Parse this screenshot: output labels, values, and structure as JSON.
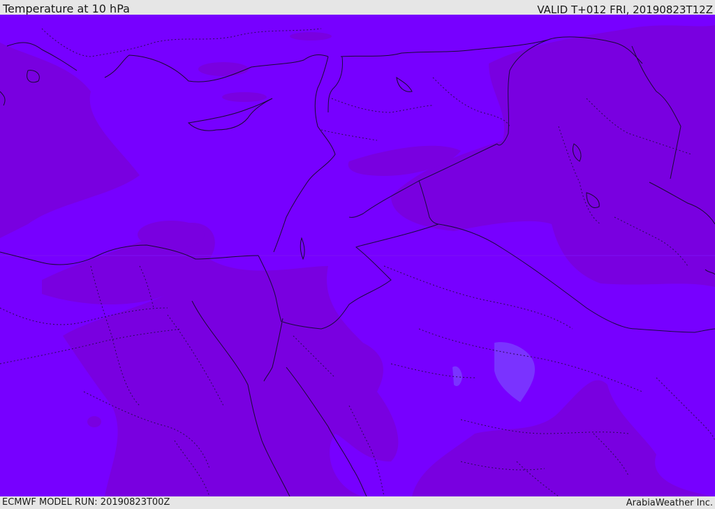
{
  "header": {
    "title": "Temperature at 10 hPa",
    "valid_time": "VALID T+012 FRI, 20190823T12Z"
  },
  "footer": {
    "model_run": "ECMWF MODEL RUN: 20190823T00Z",
    "credit": "ArabiaWeather Inc."
  },
  "map": {
    "region": "Eastern Mediterranean / Middle East",
    "colors": {
      "base_violet": "#7700ff",
      "cooler_band": "#7a00e6",
      "warm_pocket": "#7a33ff",
      "coastline": "#1a0a33",
      "border": "#1a0a40"
    }
  }
}
